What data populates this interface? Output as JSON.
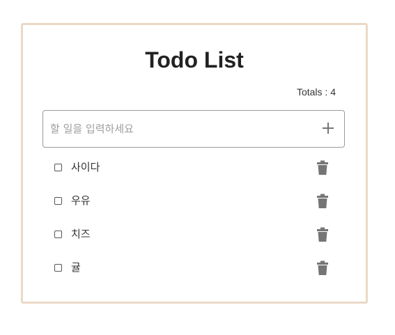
{
  "app": {
    "title": "Todo List",
    "totals_label": "Totals : ",
    "totals_count": "4"
  },
  "input": {
    "placeholder": "할 일을 입력하세요",
    "value": ""
  },
  "icons": {
    "add": "plus-icon",
    "delete": "trash-icon"
  },
  "colors": {
    "card_border": "#ead9c6",
    "icon": "#757575",
    "title": "#222222"
  },
  "todos": [
    {
      "text": "사이다",
      "checked": false
    },
    {
      "text": "우유",
      "checked": false
    },
    {
      "text": "치즈",
      "checked": false
    },
    {
      "text": "귤",
      "checked": false
    }
  ]
}
